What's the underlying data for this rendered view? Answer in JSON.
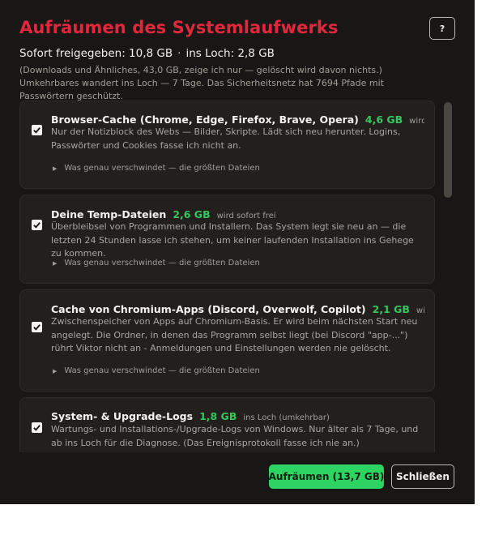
{
  "dialog": {
    "title": "Aufräumen des Systemlaufwerks",
    "help_label": "?",
    "summary": {
      "freed": "Sofort freigegeben: 10,8 GB",
      "separator": "·",
      "to_bin": "ins Loch: 2,8 GB"
    },
    "note": "(Downloads und Ähnliches, 43,0 GB, zeige ich nur — gelöscht wird davon nichts.) Umkehrbares wandert ins Loch — 7 Tage. Das Sicherheitsnetz hat 7694 Pfade mit Passwörtern geschützt."
  },
  "items": [
    {
      "checked": true,
      "title": "Browser-Cache (Chrome, Edge, Firefox, Brave, Opera)",
      "size": "4,6 GB",
      "status": "wird sofort fr",
      "description": "Nur der Notizblock des Webs — Bilder, Skripte. Lädt sich neu herunter. Logins, Passwörter und Cookies fasse ich nicht an.",
      "details": "Was genau verschwindet — die größten Dateien"
    },
    {
      "checked": true,
      "title": "Deine Temp-Dateien",
      "size": "2,6 GB",
      "status": "wird sofort frei",
      "description": "Überbleibsel von Programmen und Installern. Das System legt sie neu an — die letzten 24 Stunden lasse ich stehen, um keiner laufenden Installation ins Gehege zu kommen.",
      "details": "Was genau verschwindet — die größten Dateien"
    },
    {
      "checked": true,
      "title": "Cache von Chromium-Apps (Discord, Overwolf, Copilot)",
      "size": "2,1 GB",
      "status": "wird sofor",
      "description": "Zwischenspeicher von Apps auf Chromium-Basis. Er wird beim nächsten Start neu angelegt. Die Ordner, in denen das Programm selbst liegt (bei Discord \"app-...\") rührt Viktor nicht an - Anmeldungen und Einstellungen werden nie gelöscht.",
      "details": "Was genau verschwindet — die größten Dateien"
    },
    {
      "checked": true,
      "title": "System- & Upgrade-Logs",
      "size": "1,8 GB",
      "status": "ins Loch (umkehrbar)",
      "description": "Wartungs- und Installations-/Upgrade-Logs von Windows. Nur älter als 7 Tage, und ab ins Loch für die Diagnose. (Das Ereignisprotokoll fasse ich nie an.)",
      "details": ""
    }
  ],
  "footer": {
    "clean_label": "Aufräumen  (13,7 GB)",
    "close_label": "Schließen"
  },
  "colors": {
    "background": "#191715",
    "title": "#e2263c",
    "accent_green": "#2ed461",
    "size_green": "#36c55f",
    "card": "#221f1d"
  }
}
